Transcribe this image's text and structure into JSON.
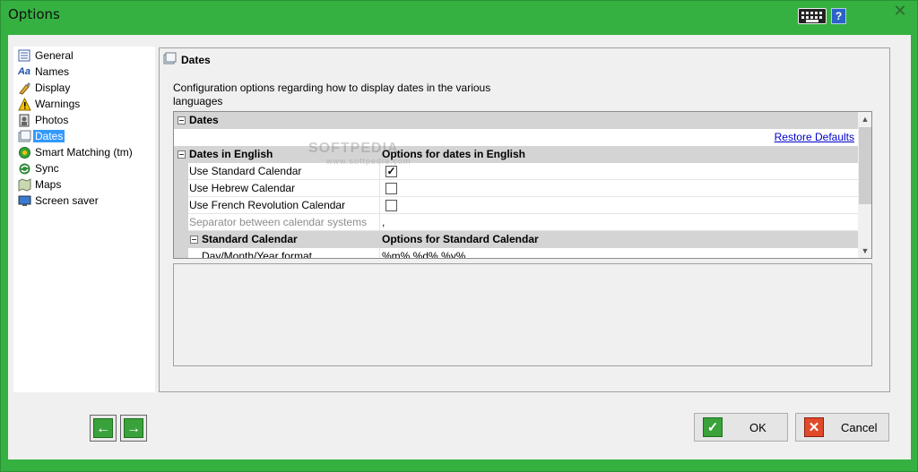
{
  "window": {
    "title": "Options"
  },
  "titlebar": {
    "help_label": "?",
    "close_label": "✕"
  },
  "sidebar": {
    "items": [
      {
        "label": "General",
        "icon": "general-icon",
        "selected": false
      },
      {
        "label": "Names",
        "icon": "names-icon",
        "selected": false
      },
      {
        "label": "Display",
        "icon": "display-icon",
        "selected": false
      },
      {
        "label": "Warnings",
        "icon": "warning-icon",
        "selected": false
      },
      {
        "label": "Photos",
        "icon": "photos-icon",
        "selected": false
      },
      {
        "label": "Dates",
        "icon": "calendar-icon",
        "selected": true
      },
      {
        "label": "Smart Matching (tm)",
        "icon": "smart-matching-icon",
        "selected": false
      },
      {
        "label": "Sync",
        "icon": "sync-icon",
        "selected": false
      },
      {
        "label": "Maps",
        "icon": "maps-icon",
        "selected": false
      },
      {
        "label": "Screen saver",
        "icon": "screensaver-icon",
        "selected": false
      }
    ]
  },
  "panel": {
    "title": "Dates",
    "description": "Configuration options regarding how to display dates in the various languages"
  },
  "grid": {
    "category": "Dates",
    "restore_defaults": "Restore Defaults",
    "section_english": {
      "name": "Dates in English",
      "value": "Options for dates in English"
    },
    "rows": [
      {
        "name": "Use Standard Calendar",
        "checked": true
      },
      {
        "name": "Use Hebrew Calendar",
        "checked": false
      },
      {
        "name": "Use French Revolution Calendar",
        "checked": false
      }
    ],
    "separator": {
      "name": "Separator between calendar systems",
      "value": ","
    },
    "section_standard": {
      "name": "Standard Calendar",
      "value": "Options for Standard Calendar"
    },
    "partial_row": {
      "name": "Day/Month/Year format",
      "value": "%m% %d% %y%"
    }
  },
  "watermark": {
    "main": "SOFTPEDIA",
    "sub": "www.softpedia.com"
  },
  "footer": {
    "back_label": "←",
    "forward_label": "→",
    "ok_label": "OK",
    "cancel_label": "Cancel"
  },
  "colors": {
    "accent": "#35b141",
    "selection": "#3399ff",
    "link": "#0000cc"
  }
}
